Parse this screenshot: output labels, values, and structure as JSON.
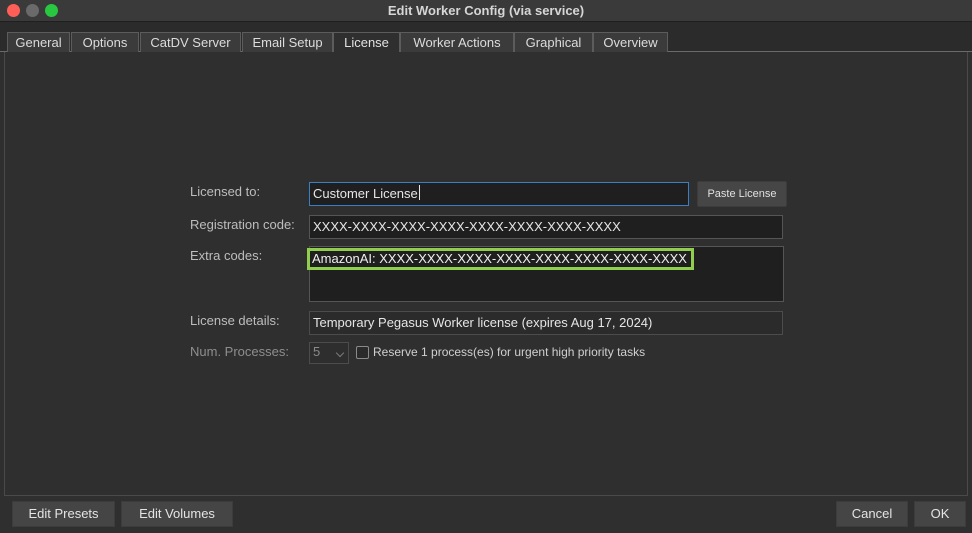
{
  "window": {
    "title": "Edit Worker Config (via service)"
  },
  "tabs": [
    "General",
    "Options",
    "CatDV Server",
    "Email Setup",
    "License",
    "Worker Actions",
    "Graphical",
    "Overview"
  ],
  "active_tab": "License",
  "license": {
    "licensed_to_label": "Licensed to:",
    "licensed_to_value": "Customer License",
    "paste_license_label": "Paste License",
    "registration_code_label": "Registration code:",
    "registration_code_value": "XXXX-XXXX-XXXX-XXXX-XXXX-XXXX-XXXX-XXXX",
    "extra_codes_label": "Extra codes:",
    "extra_codes_value": "AmazonAI: XXXX-XXXX-XXXX-XXXX-XXXX-XXXX-XXXX-XXXX",
    "license_details_label": "License details:",
    "license_details_value": "Temporary Pegasus Worker license (expires Aug 17, 2024)",
    "num_processes_label": "Num. Processes:",
    "num_processes_value": "5",
    "reserve_label": "Reserve 1 process(es) for urgent high priority tasks",
    "reserve_checked": false
  },
  "bottom": {
    "edit_presets": "Edit Presets",
    "edit_volumes": "Edit Volumes",
    "cancel": "Cancel",
    "ok": "OK"
  },
  "colors": {
    "highlight": "#8fcf4d",
    "focus": "#3a7fc4"
  }
}
